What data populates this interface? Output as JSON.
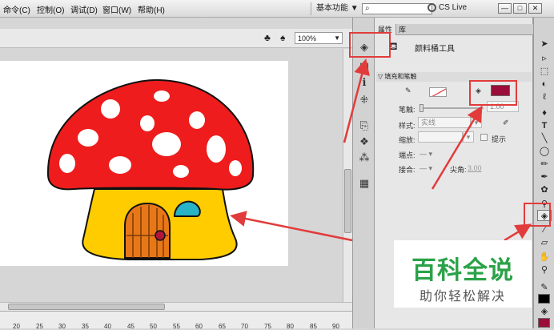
{
  "menubar": {
    "items": [
      "命令(C)",
      "控制(O)",
      "调试(D)",
      "窗口(W)",
      "帮助(H)"
    ],
    "workspace": "基本功能 ▼",
    "search_placeholder": "",
    "cs_live": "CS Live",
    "window_buttons": [
      "—",
      "□",
      "✕"
    ]
  },
  "stage": {
    "zoom": "100%",
    "ruler_ticks": [
      "20",
      "25",
      "30",
      "35",
      "40",
      "45",
      "50",
      "55",
      "60",
      "65",
      "70",
      "75",
      "80",
      "85",
      "90"
    ]
  },
  "properties": {
    "tabs": [
      "属性",
      "库"
    ],
    "tool_title": "颜料桶工具",
    "section": "填充和笔触",
    "stroke_label": "笔触:",
    "stroke_value": "1.00",
    "style_label": "样式:",
    "style_value": "实线",
    "scale_label": "缩放:",
    "hint_label": "提示",
    "cap_label": "端点:",
    "join_label": "接合:",
    "miter_label": "尖角:",
    "miter_value": "3.00",
    "fill_color": "#9b0e3a"
  },
  "watermark": {
    "main": "百科全说",
    "sub": "助你轻松解决"
  },
  "colors": {
    "highlight": "#e23b3b",
    "mushroom_cap": "#ee1c1c",
    "mushroom_body": "#ffcc00",
    "door": "#e87817",
    "window": "#29b3c6",
    "knob": "#b1143c"
  }
}
